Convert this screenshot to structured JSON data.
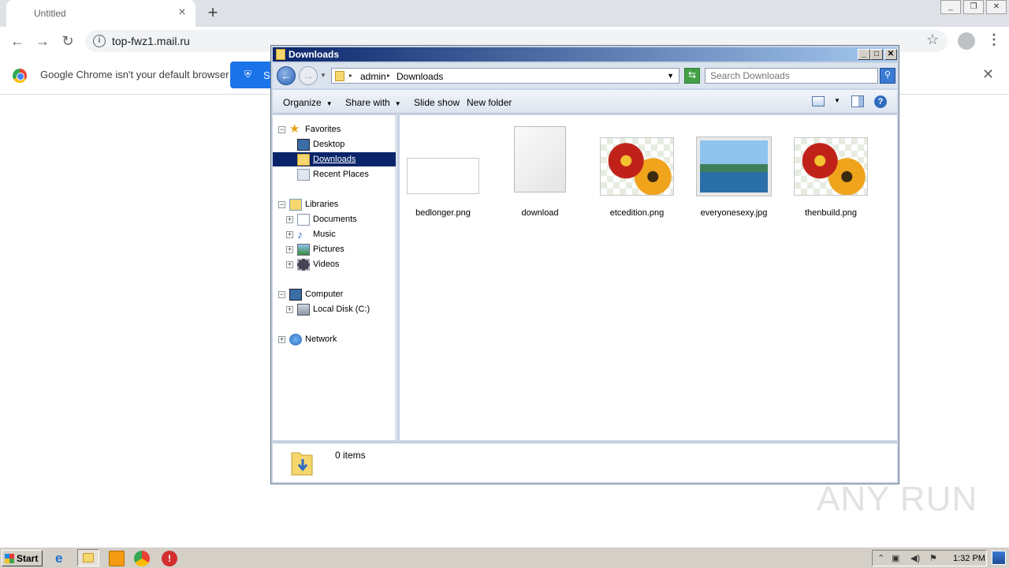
{
  "chrome": {
    "tab_title": "Untitled",
    "tab_close": "×",
    "new_tab": "+",
    "back": "←",
    "forward": "→",
    "reload": "↻",
    "url": "top-fwz1.mail.ru",
    "star": "☆",
    "menu": "⋮",
    "infobar_message": "Google Chrome isn't your default browser",
    "infobar_button": "S",
    "infobar_close": "✕"
  },
  "explorer": {
    "title": "Downloads",
    "breadcrumb": [
      "admin",
      "Downloads"
    ],
    "search_placeholder": "Search Downloads",
    "toolbar": {
      "organize": "Organize",
      "share_with": "Share with",
      "slide_show": "Slide show",
      "new_folder": "New folder"
    },
    "nav": {
      "favorites": "Favorites",
      "desktop": "Desktop",
      "downloads": "Downloads",
      "recent_places": "Recent Places",
      "libraries": "Libraries",
      "documents": "Documents",
      "music": "Music",
      "pictures": "Pictures",
      "videos": "Videos",
      "computer": "Computer",
      "local_disk": "Local Disk (C:)",
      "network": "Network"
    },
    "files": [
      {
        "name": "bedlonger.png",
        "kind": "blank-png"
      },
      {
        "name": "download",
        "kind": "generic-file"
      },
      {
        "name": "etcedition.png",
        "kind": "flower-image"
      },
      {
        "name": "everyonesexy.jpg",
        "kind": "landscape-image"
      },
      {
        "name": "thenbuild.png",
        "kind": "flower-image"
      }
    ],
    "status": "0 items"
  },
  "watermark": "ANY  RUN",
  "taskbar": {
    "start": "Start",
    "clock": "1:32 PM"
  }
}
